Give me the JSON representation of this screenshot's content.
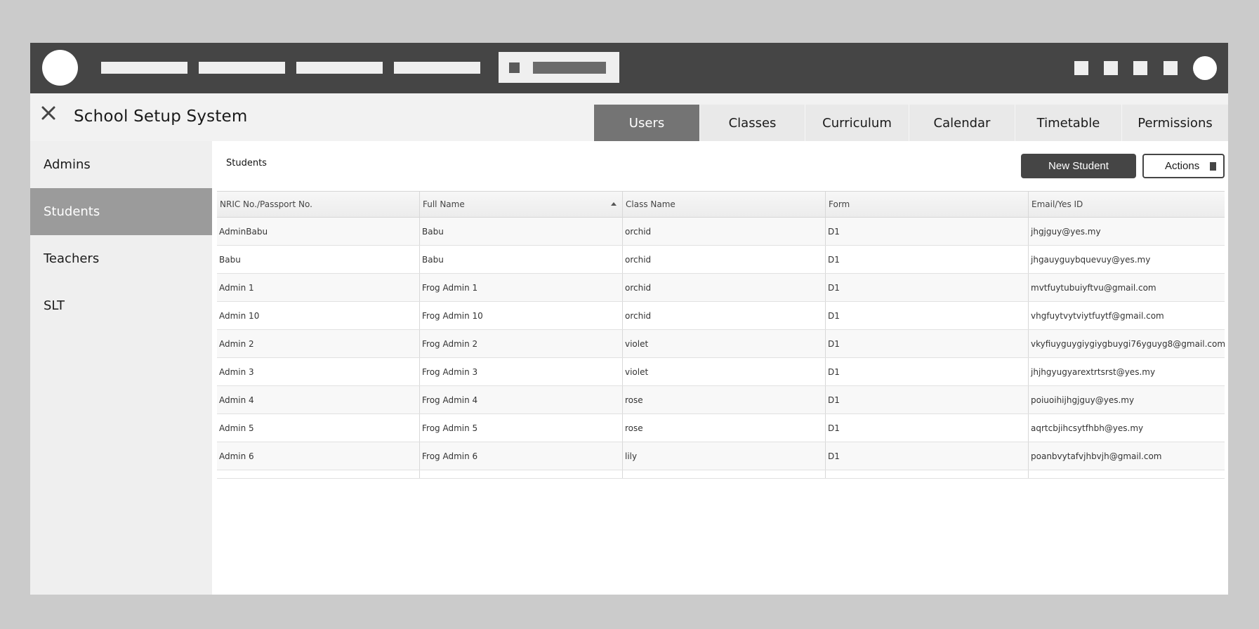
{
  "app": {
    "title": "School Setup System"
  },
  "tabs": [
    {
      "label": "Users",
      "active": true
    },
    {
      "label": "Classes",
      "active": false
    },
    {
      "label": "Curriculum",
      "active": false
    },
    {
      "label": "Calendar",
      "active": false
    },
    {
      "label": "Timetable",
      "active": false
    },
    {
      "label": "Permissions",
      "active": false
    }
  ],
  "sidebar": {
    "items": [
      {
        "label": "Admins",
        "active": false
      },
      {
        "label": "Students",
        "active": true
      },
      {
        "label": "Teachers",
        "active": false
      },
      {
        "label": "SLT",
        "active": false
      }
    ]
  },
  "main": {
    "section_title": "Students",
    "new_button": "New Student",
    "actions_button": "Actions"
  },
  "table": {
    "columns": [
      "NRIC No./Passport No.",
      "Full Name",
      "Class Name",
      "Form",
      "Email/Yes ID"
    ],
    "sorted_column": "Full Name",
    "rows": [
      [
        "AdminBabu",
        "Babu",
        "orchid",
        "D1",
        "jhgjguy@yes.my"
      ],
      [
        "Babu",
        "Babu",
        "orchid",
        "D1",
        "jhgauyguybquevuy@yes.my"
      ],
      [
        "Admin 1",
        "Frog Admin 1",
        "orchid",
        "D1",
        "mvtfuytubuiyftvu@gmail.com"
      ],
      [
        "Admin 10",
        "Frog Admin 10",
        "orchid",
        "D1",
        "vhgfuytvytviytfuytf@gmail.com"
      ],
      [
        "Admin 2",
        "Frog Admin 2",
        "violet",
        "D1",
        "vkyfiuyguygiygiygbuygi76yguyg8@gmail.com"
      ],
      [
        "Admin 3",
        "Frog Admin 3",
        "violet",
        "D1",
        "jhjhgyugyarextrtsrst@yes.my"
      ],
      [
        "Admin 4",
        "Frog Admin 4",
        "rose",
        "D1",
        "poiuoihijhgjguy@yes.my"
      ],
      [
        "Admin 5",
        "Frog Admin 5",
        "rose",
        "D1",
        "aqrtcbjihcsytfhbh@yes.my"
      ],
      [
        "Admin 6",
        "Frog Admin 6",
        "lily",
        "D1",
        "poanbvytafvjhbvjh@gmail.com"
      ]
    ]
  },
  "icons": {
    "close": "close-icon",
    "sort": "sort-ascending-icon"
  },
  "colors": {
    "topbar": "#454545",
    "active_tab": "#747474",
    "active_sidebar": "#9b9b9b",
    "background": "#cbcbcb"
  }
}
